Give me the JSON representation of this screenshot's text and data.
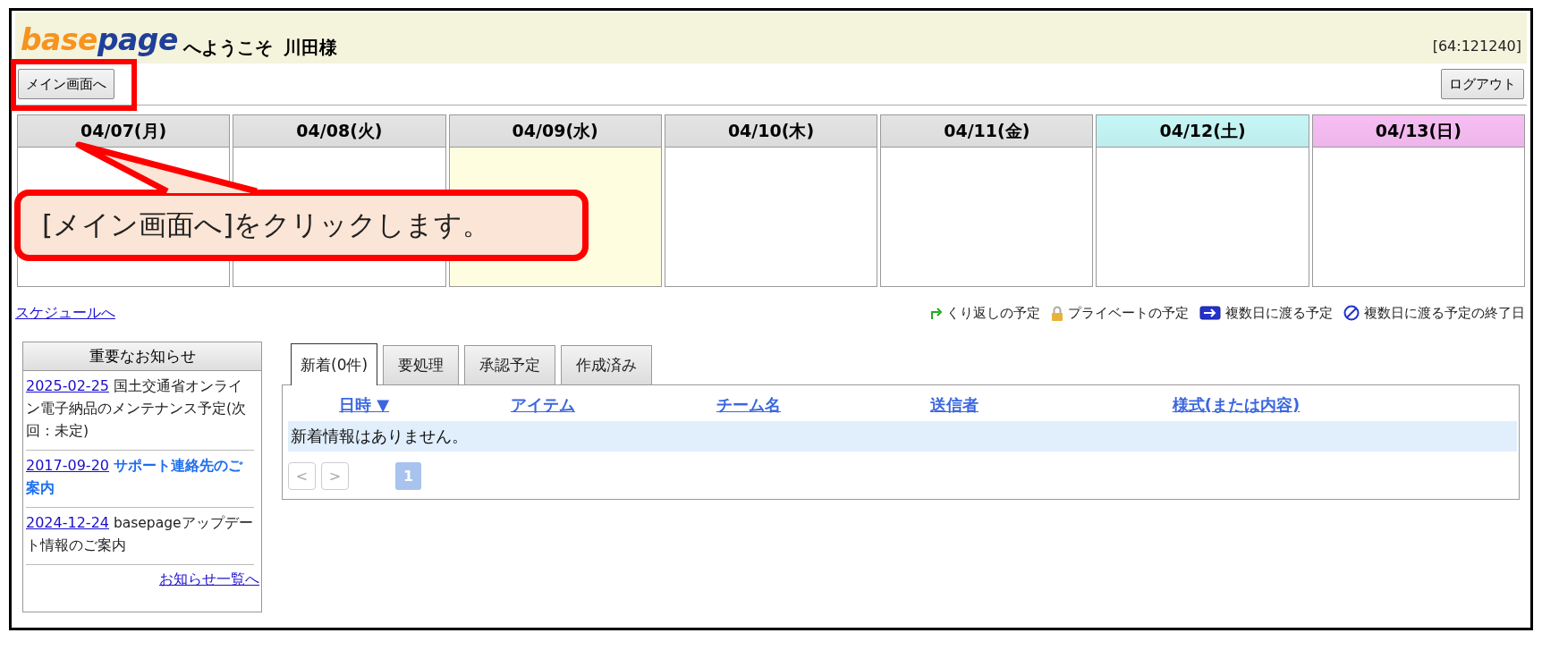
{
  "header": {
    "logo": [
      "base",
      "page"
    ],
    "welcome": "へようこそ",
    "user": "川田様",
    "session": "[64:121240]"
  },
  "buttons": {
    "main": "メイン画面へ",
    "logout": "ログアウト"
  },
  "calendar": [
    {
      "date": "04/07(月)",
      "color": "#e4e4e4",
      "today": false
    },
    {
      "date": "04/08(火)",
      "color": "#e4e4e4",
      "today": false
    },
    {
      "date": "04/09(水)",
      "color": "#e4e4e4",
      "today": true
    },
    {
      "date": "04/10(木)",
      "color": "#e4e4e4",
      "today": false
    },
    {
      "date": "04/11(金)",
      "color": "#e4e4e4",
      "today": false
    },
    {
      "date": "04/12(土)",
      "color": "#c6f6f6",
      "today": false
    },
    {
      "date": "04/13(日)",
      "color": "#f7bdf4",
      "today": false
    }
  ],
  "callout": {
    "text": "[メイン画面へ]をクリックします。"
  },
  "schedule_link": "スケジュールへ",
  "legend": [
    {
      "kind": "repeat",
      "label": "くり返しの予定"
    },
    {
      "kind": "lock",
      "label": "プライベートの予定"
    },
    {
      "kind": "multiday",
      "label": "複数日に渡る予定"
    },
    {
      "kind": "end",
      "label": "複数日に渡る予定の終了日"
    }
  ],
  "notices": {
    "title": "重要なお知らせ",
    "items": [
      {
        "date": "2025-02-25",
        "text": "国土交通省オンライン電子納品のメンテナンス予定(次回：未定)",
        "highlighted": false
      },
      {
        "date": "2017-09-20",
        "text": "サポート連絡先のご案内",
        "highlighted": true
      },
      {
        "date": "2024-12-24",
        "text": "basepageアップデート情報のご案内",
        "highlighted": false
      }
    ],
    "more": "お知らせ一覧へ"
  },
  "tabs": [
    {
      "label": "新着(0件)",
      "selected": true
    },
    {
      "label": "要処理",
      "selected": false
    },
    {
      "label": "承認予定",
      "selected": false
    },
    {
      "label": "作成済み",
      "selected": false
    }
  ],
  "table": {
    "columns": [
      "日時 ▼",
      "アイテム",
      "チーム名",
      "送信者",
      "様式(または内容)"
    ],
    "empty": "新着情報はありません。"
  },
  "pagination": {
    "prev": "<",
    "next": ">",
    "pages": [
      {
        "label": "1",
        "selected": true
      }
    ]
  }
}
